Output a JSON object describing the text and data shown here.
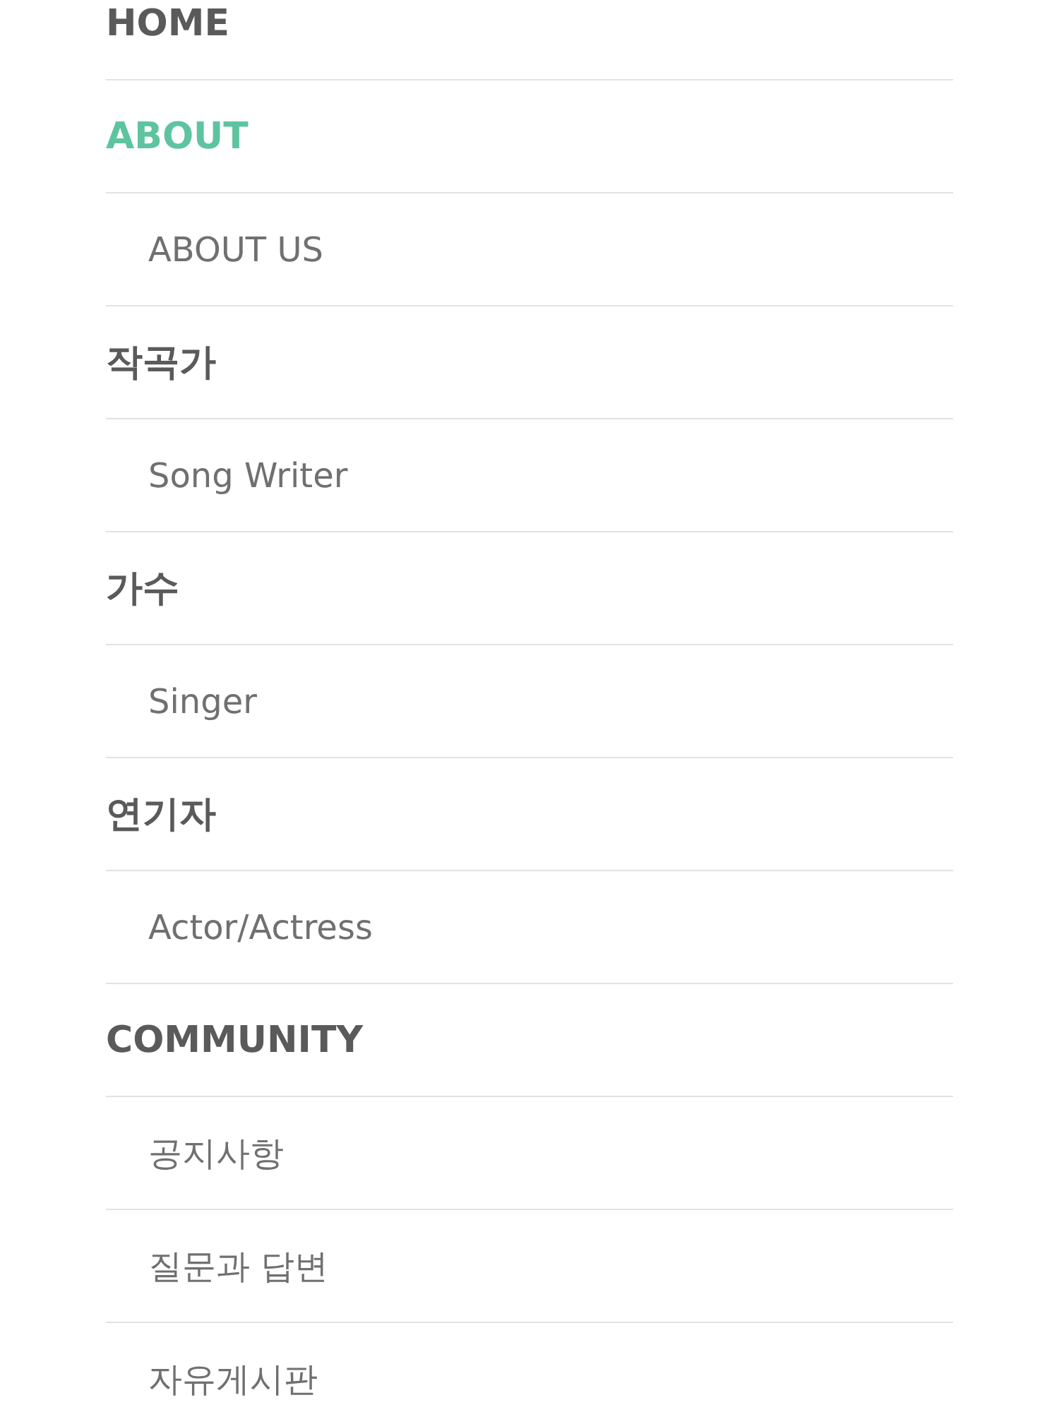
{
  "menu": [
    {
      "kind": "section",
      "label": "HOME",
      "selected": false
    },
    {
      "kind": "section",
      "label": "ABOUT",
      "selected": true
    },
    {
      "kind": "sub",
      "label": "ABOUT US",
      "selected": false
    },
    {
      "kind": "section",
      "label": "작곡가",
      "selected": false
    },
    {
      "kind": "sub",
      "label": "Song Writer",
      "selected": false
    },
    {
      "kind": "section",
      "label": "가수",
      "selected": false
    },
    {
      "kind": "sub",
      "label": "Singer",
      "selected": false
    },
    {
      "kind": "section",
      "label": "연기자",
      "selected": false
    },
    {
      "kind": "sub",
      "label": "Actor/Actress",
      "selected": false
    },
    {
      "kind": "section",
      "label": "COMMUNITY",
      "selected": false
    },
    {
      "kind": "sub",
      "label": "공지사항",
      "selected": false
    },
    {
      "kind": "sub",
      "label": "질문과 답변",
      "selected": false
    },
    {
      "kind": "sub",
      "label": "자유게시판",
      "selected": false
    }
  ]
}
